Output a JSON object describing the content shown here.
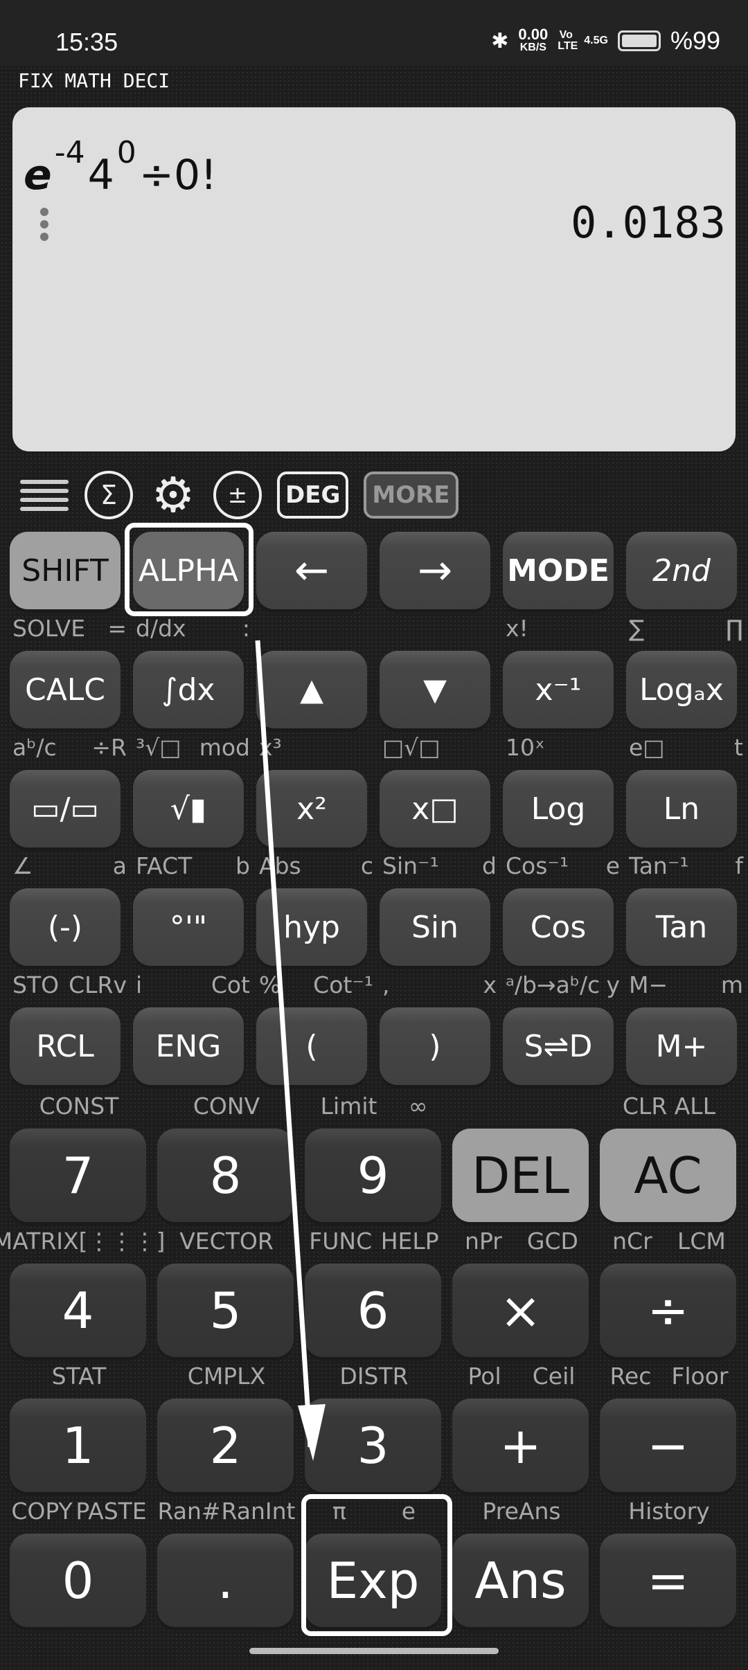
{
  "status": {
    "time": "15:35",
    "net_speed": "0.00",
    "net_unit": "KB/S",
    "volte": "Vo LTE",
    "network": "4.5G",
    "battery": "%99",
    "battery_level": 0.99
  },
  "modes": "FIX MATH DECI",
  "display": {
    "expr": {
      "base": "e",
      "exp1": "-4",
      "num": "4",
      "exp2": "0",
      "rest": "÷0!"
    },
    "result": "0.0183"
  },
  "toolbar": {
    "sigma": "Σ",
    "deg": "DEG",
    "more": "MORE"
  },
  "small_rows": [
    {
      "labels": [],
      "keys": [
        "SHIFT",
        "ALPHA",
        "←",
        "→",
        "MODE",
        "2nd"
      ]
    },
    {
      "labels": [
        [
          "SOLVE",
          "="
        ],
        [
          "d/dx",
          ":"
        ],
        [
          "",
          ""
        ],
        [
          "",
          ""
        ],
        [
          "x!",
          ""
        ],
        [
          "∑",
          "∏"
        ]
      ],
      "keys": [
        "CALC",
        "∫dx",
        "▲",
        "▼",
        "x⁻¹",
        "Logₐx"
      ]
    },
    {
      "labels": [
        [
          "aᵇ/c",
          "÷R"
        ],
        [
          "³√□",
          "mod"
        ],
        [
          "x³",
          ""
        ],
        [
          "□√□",
          ""
        ],
        [
          "10ˣ",
          ""
        ],
        [
          "e□",
          "t"
        ]
      ],
      "keys": [
        "▭/▭",
        "√▮",
        "x²",
        "x□",
        "Log",
        "Ln"
      ]
    },
    {
      "labels": [
        [
          "∠",
          "a"
        ],
        [
          "FACT",
          "b"
        ],
        [
          "Abs",
          "c"
        ],
        [
          "Sin⁻¹",
          "d"
        ],
        [
          "Cos⁻¹",
          "e"
        ],
        [
          "Tan⁻¹",
          "f"
        ]
      ],
      "keys": [
        "(-)",
        "°'\"",
        "hyp",
        "Sin",
        "Cos",
        "Tan"
      ]
    },
    {
      "labels": [
        [
          "STO",
          "CLRv"
        ],
        [
          "i",
          "Cot"
        ],
        [
          "%",
          "Cot⁻¹"
        ],
        [
          ",",
          "x"
        ],
        [
          "ᵃ/b→aᵇ/c",
          "y"
        ],
        [
          "M−",
          "m"
        ]
      ],
      "keys": [
        "RCL",
        "ENG",
        "(",
        ")",
        "S⇌D",
        "M+"
      ]
    }
  ],
  "big_rows": [
    {
      "labels": [
        [
          "CONST"
        ],
        [
          "CONV"
        ],
        [
          "Limit",
          "∞"
        ],
        [
          ""
        ],
        [
          "CLR ALL"
        ]
      ],
      "keys": [
        "7",
        "8",
        "9",
        "DEL",
        "AC"
      ]
    },
    {
      "labels": [
        [
          "MATRIX[⋮⋮⋮]"
        ],
        [
          "VECTOR"
        ],
        [
          "FUNC",
          "HELP"
        ],
        [
          "nPr",
          "GCD"
        ],
        [
          "nCr",
          "LCM"
        ]
      ],
      "keys": [
        "4",
        "5",
        "6",
        "×",
        "÷"
      ]
    },
    {
      "labels": [
        [
          "STAT"
        ],
        [
          "CMPLX"
        ],
        [
          "DISTR"
        ],
        [
          "Pol",
          "Ceil"
        ],
        [
          "Rec",
          "Floor"
        ]
      ],
      "keys": [
        "1",
        "2",
        "3",
        "+",
        "−"
      ]
    },
    {
      "labels": [
        [
          "COPY",
          "PASTE"
        ],
        [
          "Ran#",
          "RanInt"
        ],
        [
          "π",
          "e"
        ],
        [
          "PreAns"
        ],
        [
          "History"
        ]
      ],
      "keys": [
        "0",
        ".",
        "Exp",
        "Ans",
        "="
      ]
    }
  ],
  "annotation": {
    "highlight_from": "ALPHA",
    "highlight_to": "Exp",
    "arrow_color": "#ffffff"
  },
  "colors": {
    "background": "#1d1d1d",
    "display": "#dedede",
    "key": "#444444",
    "shift_key": "#a0a0a0"
  }
}
